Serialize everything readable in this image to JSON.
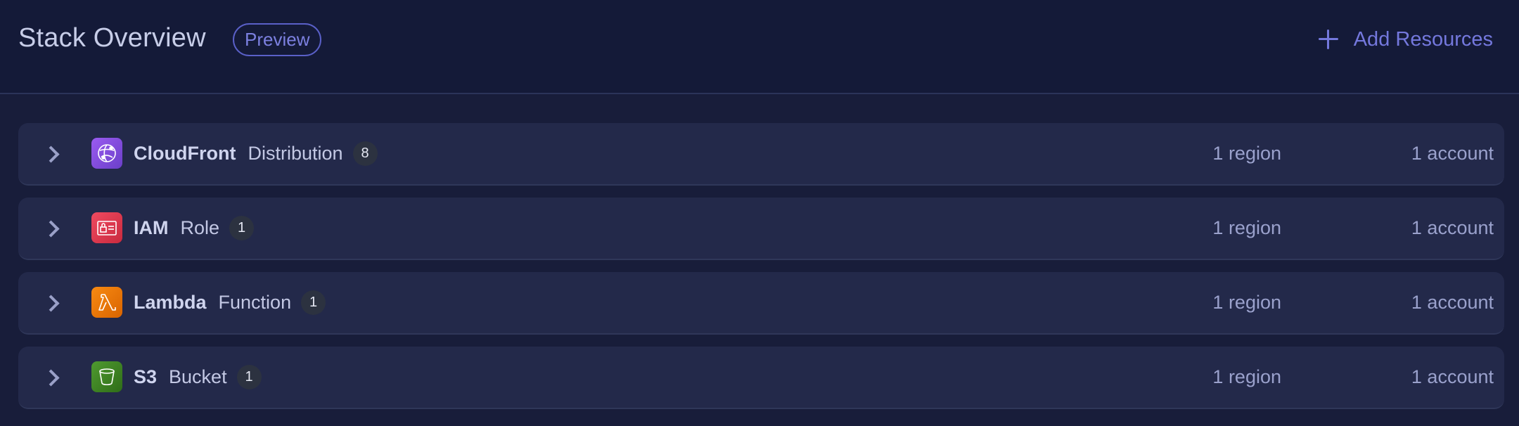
{
  "header": {
    "title": "Stack Overview",
    "badge": "Preview",
    "add_button_label": "Add Resources"
  },
  "colors": {
    "background": "#181d3a",
    "header_background": "#141a38",
    "row_background": "#23294a",
    "accent": "#7478dd",
    "cloudfront": "#8c4fe0",
    "iam": "#dd344c",
    "lambda": "#ed7100",
    "s3": "#3f8624"
  },
  "rows": [
    {
      "service": "CloudFront",
      "type": "Distribution",
      "count": "8",
      "regions": "1 region",
      "accounts": "1 account",
      "icon": "cloudfront-icon"
    },
    {
      "service": "IAM",
      "type": "Role",
      "count": "1",
      "regions": "1 region",
      "accounts": "1 account",
      "icon": "iam-icon"
    },
    {
      "service": "Lambda",
      "type": "Function",
      "count": "1",
      "regions": "1 region",
      "accounts": "1 account",
      "icon": "lambda-icon"
    },
    {
      "service": "S3",
      "type": "Bucket",
      "count": "1",
      "regions": "1 region",
      "accounts": "1 account",
      "icon": "s3-icon"
    }
  ]
}
